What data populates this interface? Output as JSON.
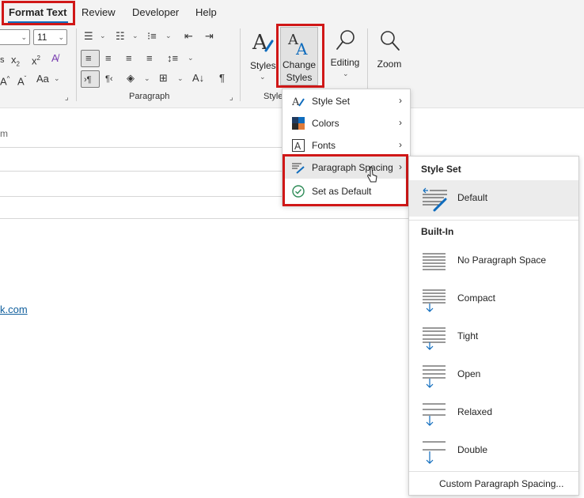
{
  "tabs": [
    {
      "label": "Format Text",
      "active": true
    },
    {
      "label": "Review"
    },
    {
      "label": "Developer"
    },
    {
      "label": "Help"
    }
  ],
  "font": {
    "size": "11"
  },
  "ribbon": {
    "groups": {
      "paragraph": "Paragraph",
      "styles": "Style"
    },
    "styles_button": "Styles",
    "change_styles_line1": "Change",
    "change_styles_line2": "Styles",
    "editing_button": "Editing",
    "zoom_button": "Zoom"
  },
  "body": {
    "fragment_m": "m",
    "link_text": "k.com"
  },
  "change_styles_menu": {
    "items": [
      {
        "label": "Style Set",
        "icon": "style-set-icon",
        "submenu": true
      },
      {
        "label": "Colors",
        "icon": "colors-icon",
        "submenu": true
      },
      {
        "label": "Fonts",
        "icon": "fonts-icon",
        "submenu": true
      },
      {
        "label": "Paragraph Spacing",
        "icon": "paragraph-spacing-icon",
        "submenu": true,
        "hover": true
      },
      {
        "label": "Set as Default",
        "icon": "checkmark-circle-icon",
        "submenu": false
      }
    ]
  },
  "paragraph_spacing_menu": {
    "style_set_heading": "Style Set",
    "default_label": "Default",
    "builtin_heading": "Built-In",
    "builtin_items": [
      {
        "label": "No Paragraph Space"
      },
      {
        "label": "Compact"
      },
      {
        "label": "Tight"
      },
      {
        "label": "Open"
      },
      {
        "label": "Relaxed"
      },
      {
        "label": "Double"
      }
    ],
    "custom_label": "Custom Paragraph Spacing..."
  },
  "colors": {
    "accent": "#0f6cbd",
    "highlight_box": "#d01717",
    "link": "#0f5e9c",
    "check_green": "#2e8b57"
  }
}
